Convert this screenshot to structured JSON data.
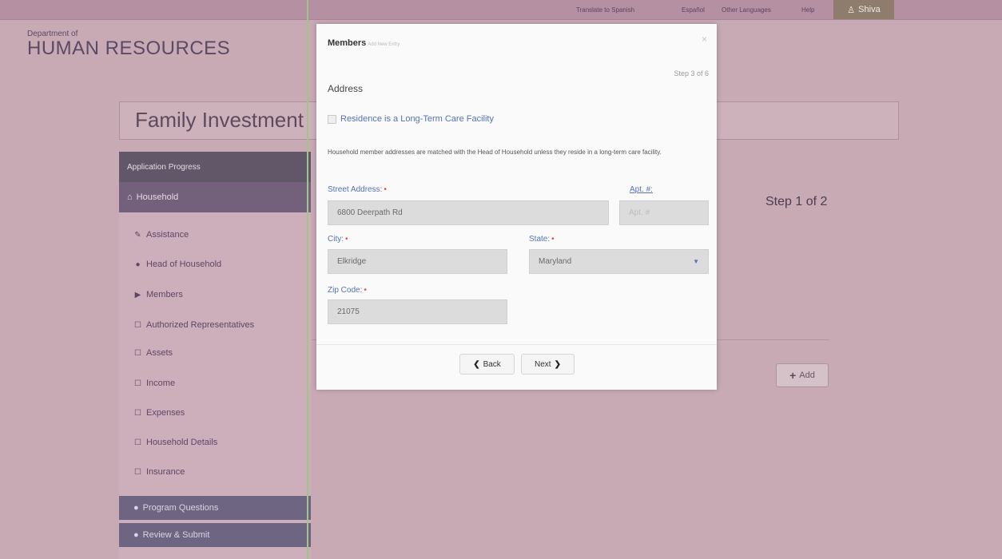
{
  "topnav": {
    "translate": "Translate to Spanish",
    "espanol": "Español",
    "other_languages": "Other Languages",
    "help": "Help",
    "user": "Shiva"
  },
  "brand": {
    "department": "Department of",
    "name": "HUMAN RESOURCES"
  },
  "page": {
    "program_title": "Family Investment",
    "step": "Step 1 of 2",
    "add_button": "Add"
  },
  "sidebar": {
    "header": "Application Progress",
    "active": "Household",
    "items": [
      {
        "label": "Assistance",
        "icon": "edit-icon"
      },
      {
        "label": "Head of Household",
        "icon": "info-circle-icon"
      },
      {
        "label": "Members",
        "icon": "play-arrow-icon"
      },
      {
        "label": "Authorized Representatives",
        "icon": "square-icon"
      },
      {
        "label": "Assets",
        "icon": "square-icon"
      },
      {
        "label": "Income",
        "icon": "square-icon"
      },
      {
        "label": "Expenses",
        "icon": "square-icon"
      },
      {
        "label": "Household Details",
        "icon": "square-icon"
      },
      {
        "label": "Insurance",
        "icon": "square-icon"
      }
    ],
    "program_questions": "Program Questions",
    "review_submit": "Review & Submit"
  },
  "modal": {
    "title": "Members",
    "title_sub": "Add New Entry",
    "close": "×",
    "step": "Step 3 of 6",
    "heading": "Address",
    "checkbox_label": "Residence is a Long-Term Care Facility",
    "info": "Household member addresses are matched with the Head of Household unless they reside in a long-term care facility.",
    "street_label": "Street Address:",
    "street_value": "6800 Deerpath Rd",
    "apt_label": "Apt. #:",
    "apt_placeholder": "Apt. #",
    "city_label": "City:",
    "city_value": "Elkridge",
    "state_label": "State:",
    "state_value": "Maryland",
    "zip_label": "Zip Code:",
    "zip_value": "21075",
    "back": "Back",
    "next": "Next"
  }
}
